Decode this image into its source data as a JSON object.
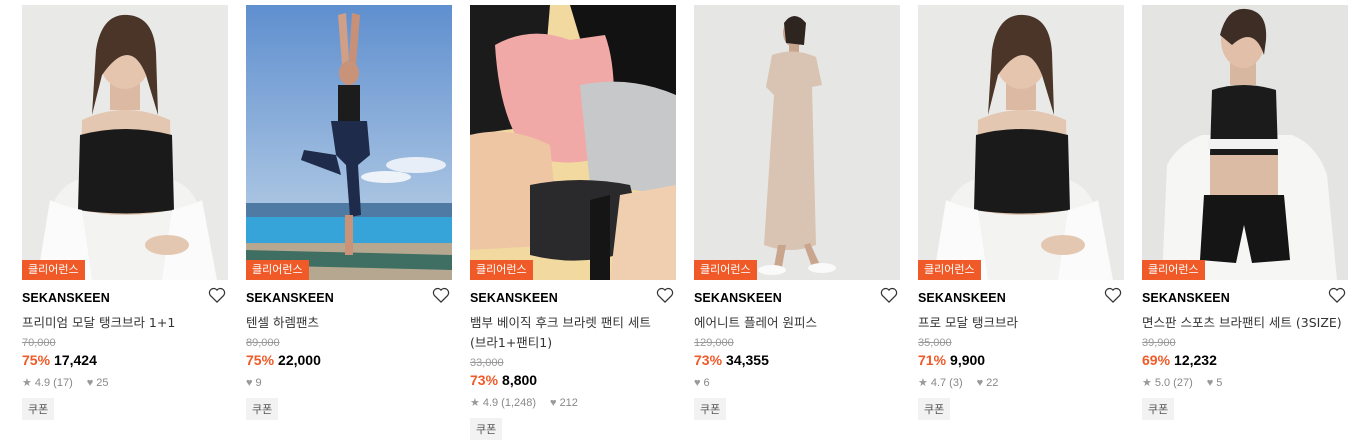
{
  "products": [
    {
      "badge": "클리어런스",
      "brand": "SEKANSKEEN",
      "name": "프리미엄 모달 탱크브라 1+1",
      "name2": "",
      "original_price": "70,000",
      "discount": "75%",
      "price": "17,424",
      "rating": "4.9",
      "reviews": "(17)",
      "likes": "25",
      "coupon": "쿠폰",
      "image": "model-black-bralette-white-shirt"
    },
    {
      "badge": "클리어런스",
      "brand": "SEKANSKEEN",
      "name": "텐셀 하렘팬츠",
      "name2": "",
      "original_price": "89,000",
      "discount": "75%",
      "price": "22,000",
      "rating": "",
      "reviews": "",
      "likes": "9",
      "coupon": "쿠폰",
      "image": "yoga-pose-poolside"
    },
    {
      "badge": "클리어런스",
      "brand": "SEKANSKEEN",
      "name": "뱀부 베이직 후크 브라렛 팬티 세트",
      "name2": "(브라1+팬티1)",
      "original_price": "33,000",
      "discount": "73%",
      "price": "8,800",
      "rating": "4.9",
      "reviews": "(1,248)",
      "likes": "212",
      "coupon": "쿠폰",
      "image": "flatlay-bralettes"
    },
    {
      "badge": "클리어런스",
      "brand": "SEKANSKEEN",
      "name": "에어니트 플레어 원피스",
      "name2": "",
      "original_price": "129,000",
      "discount": "73%",
      "price": "34,355",
      "rating": "",
      "reviews": "",
      "likes": "6",
      "coupon": "쿠폰",
      "image": "model-beige-dress"
    },
    {
      "badge": "클리어런스",
      "brand": "SEKANSKEEN",
      "name": "프로 모달 탱크브라",
      "name2": "",
      "original_price": "35,000",
      "discount": "71%",
      "price": "9,900",
      "rating": "4.7",
      "reviews": "(3)",
      "likes": "22",
      "coupon": "쿠폰",
      "image": "model-black-bralette-white-shirt"
    },
    {
      "badge": "클리어런스",
      "brand": "SEKANSKEEN",
      "name": "면스판 스포츠 브라팬티 세트 (3SIZE)",
      "name2": "",
      "original_price": "39,900",
      "discount": "69%",
      "price": "12,232",
      "rating": "5.0",
      "reviews": "(27)",
      "likes": "5",
      "coupon": "쿠폰",
      "image": "model-sports-bra-set"
    }
  ],
  "colors": {
    "accent": "#f05a28",
    "muted": "#999999"
  }
}
